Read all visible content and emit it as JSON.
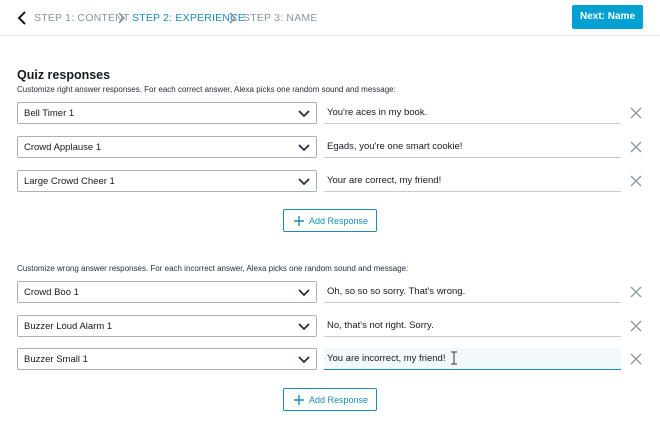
{
  "header": {
    "back_icon": "chevron-left-icon",
    "steps": [
      {
        "label": "STEP 1: CONTENT",
        "state": "done"
      },
      {
        "label": "STEP 2: EXPERIENCE",
        "state": "active"
      },
      {
        "label": "STEP 3: NAME",
        "state": "upcoming"
      }
    ],
    "next_label": "Next: Name",
    "accent_color": "#00a0d2"
  },
  "quiz": {
    "title": "Quiz responses",
    "right": {
      "description": "Customize right answer responses. For each correct answer, Alexa picks one random sound and message:",
      "rows": [
        {
          "sound": "Bell Timer 1",
          "message": "You're aces in my book."
        },
        {
          "sound": "Crowd Applause 1",
          "message": "Egads, you're one smart cookie!"
        },
        {
          "sound": "Large Crowd Cheer 1",
          "message": "Your are correct, my friend!"
        }
      ],
      "add_label": "Add Response"
    },
    "wrong": {
      "description": "Customize wrong answer responses. For each incorrect answer, Alexa picks one random sound and message:",
      "rows": [
        {
          "sound": "Crowd Boo 1",
          "message": "Oh, so so so sorry. That's wrong."
        },
        {
          "sound": "Buzzer Loud Alarm 1",
          "message": "No, that's not right. Sorry."
        },
        {
          "sound": "Buzzer Small 1",
          "message": "You are incorrect, my friend!"
        }
      ],
      "add_label": "Add Response"
    }
  }
}
